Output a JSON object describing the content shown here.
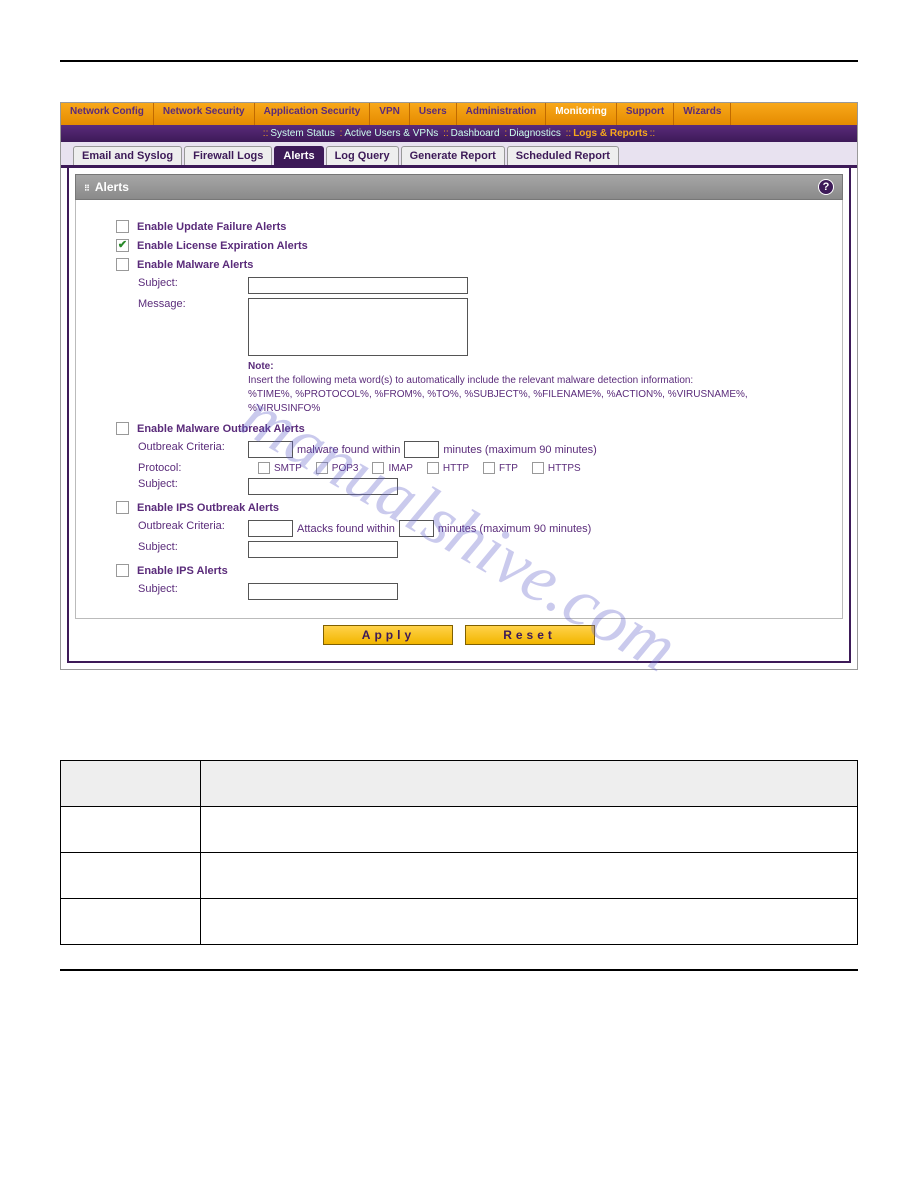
{
  "mainTabs": {
    "items": [
      "Network Config",
      "Network Security",
      "Application Security",
      "VPN",
      "Users",
      "Administration",
      "Monitoring",
      "Support",
      "Wizards"
    ],
    "active": 6
  },
  "subnav": {
    "items": [
      "System Status",
      "Active Users & VPNs",
      "Dashboard",
      "Diagnostics",
      "Logs & Reports"
    ],
    "active": 4
  },
  "subTabs": {
    "items": [
      "Email and Syslog",
      "Firewall Logs",
      "Alerts",
      "Log Query",
      "Generate Report",
      "Scheduled Report"
    ],
    "active": 2
  },
  "section": {
    "title": "Alerts"
  },
  "form": {
    "updateFailure": {
      "label": "Enable Update Failure Alerts",
      "checked": false
    },
    "licenseExp": {
      "label": "Enable License Expiration Alerts",
      "checked": true
    },
    "malware": {
      "label": "Enable Malware Alerts",
      "checked": false,
      "subjectLabel": "Subject:",
      "subject": "",
      "messageLabel": "Message:",
      "message": "",
      "noteTitle": "Note:",
      "noteLine1": "Insert the following meta word(s) to automatically include the relevant malware detection information:",
      "noteLine2": "%TIME%, %PROTOCOL%, %FROM%, %TO%, %SUBJECT%, %FILENAME%, %ACTION%, %VIRUSNAME%, %VIRUSINFO%"
    },
    "outbreak": {
      "label": "Enable Malware Outbreak Alerts",
      "checked": false,
      "criteriaLabel": "Outbreak Criteria:",
      "critCount": "",
      "critText1": "malware found within",
      "critMinutes": "",
      "critText2": "minutes (maximum 90 minutes)",
      "protoLabel": "Protocol:",
      "protocols": [
        "SMTP",
        "POP3",
        "IMAP",
        "HTTP",
        "FTP",
        "HTTPS"
      ],
      "subjectLabel": "Subject:",
      "subject": ""
    },
    "ipsOutbreak": {
      "label": "Enable IPS Outbreak Alerts",
      "checked": false,
      "criteriaLabel": "Outbreak Criteria:",
      "critCount": "",
      "critText1": "Attacks found within",
      "critMinutes": "",
      "critText2": "minutes (maximum 90 minutes)",
      "subjectLabel": "Subject:",
      "subject": ""
    },
    "ips": {
      "label": "Enable IPS Alerts",
      "checked": false,
      "subjectLabel": "Subject:",
      "subject": ""
    }
  },
  "buttons": {
    "apply": "Apply",
    "reset": "Reset"
  },
  "watermark": "manualshive.com"
}
